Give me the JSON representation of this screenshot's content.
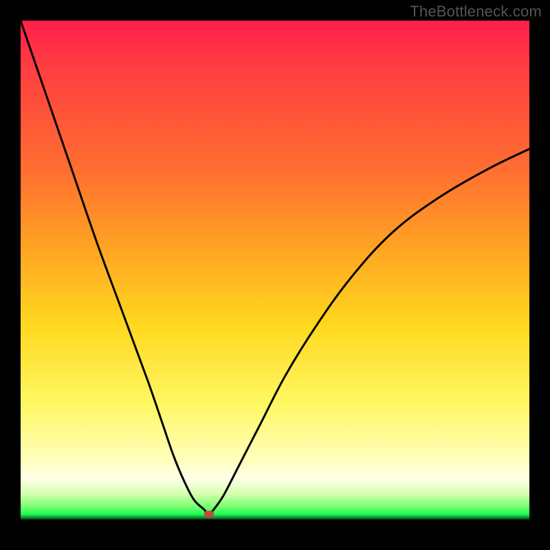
{
  "watermark": "TheBottleneck.com",
  "colors": {
    "curve_stroke": "#000000",
    "marker_fill": "#c24a3a",
    "frame_bg": "#000000"
  },
  "chart_data": {
    "type": "line",
    "title": "",
    "xlabel": "",
    "ylabel": "",
    "xlim": [
      0,
      100
    ],
    "ylim": [
      0,
      100
    ],
    "grid": false,
    "legend": false,
    "series": [
      {
        "name": "bottleneck-curve",
        "x": [
          0,
          5,
          10,
          15,
          20,
          25,
          28,
          30,
          32,
          34,
          36,
          37,
          38,
          40,
          43,
          47,
          52,
          58,
          65,
          73,
          82,
          92,
          100
        ],
        "y": [
          100,
          85,
          70,
          55,
          41,
          27,
          18,
          12,
          7,
          3,
          1,
          0,
          1,
          4,
          10,
          18,
          28,
          38,
          48,
          57,
          64,
          70,
          74
        ]
      }
    ],
    "marker": {
      "x": 37,
      "y": 0
    },
    "gradient_stops": [
      {
        "pos": 0.0,
        "color": "#ff1f4a"
      },
      {
        "pos": 0.3,
        "color": "#ff7030"
      },
      {
        "pos": 0.6,
        "color": "#ffd820"
      },
      {
        "pos": 0.9,
        "color": "#ffffe8"
      },
      {
        "pos": 0.96,
        "color": "#1dff55"
      },
      {
        "pos": 0.985,
        "color": "#000000"
      }
    ]
  }
}
